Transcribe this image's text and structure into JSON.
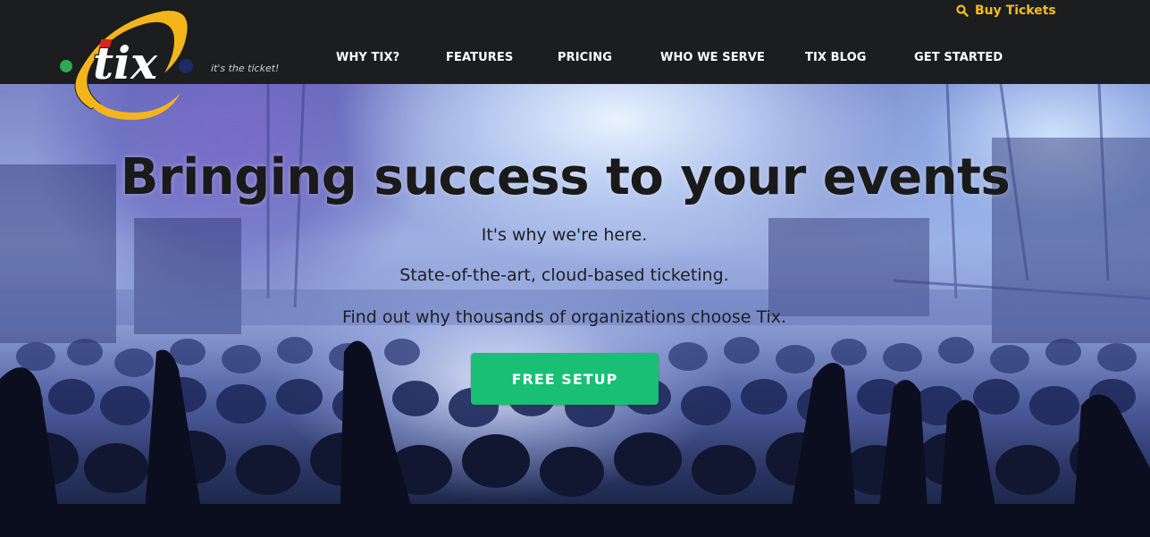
{
  "brand": {
    "logo_text": "tix",
    "tagline": "it's the ticket!"
  },
  "header": {
    "buy_tickets_label": "Buy Tickets",
    "nav": [
      {
        "label": "WHY TIX?"
      },
      {
        "label": "FEATURES"
      },
      {
        "label": "PRICING"
      },
      {
        "label": "WHO WE SERVE"
      },
      {
        "label": "TIX BLOG"
      },
      {
        "label": "GET STARTED"
      }
    ]
  },
  "hero": {
    "title": "Bringing success to your events",
    "lines": [
      "It's why we're here.",
      "State-of-the-art, cloud-based ticketing.",
      "Find out why thousands of organizations choose Tix."
    ],
    "cta_label": "FREE SETUP"
  },
  "colors": {
    "header_bg": "#1b1d1f",
    "accent_gold": "#f5bd1c",
    "cta_green": "#18bf74",
    "logo_red": "#d9261c",
    "logo_green": "#2fa84f",
    "logo_navy": "#1e2a66"
  },
  "icons": {
    "buy_tickets": "search-icon"
  }
}
